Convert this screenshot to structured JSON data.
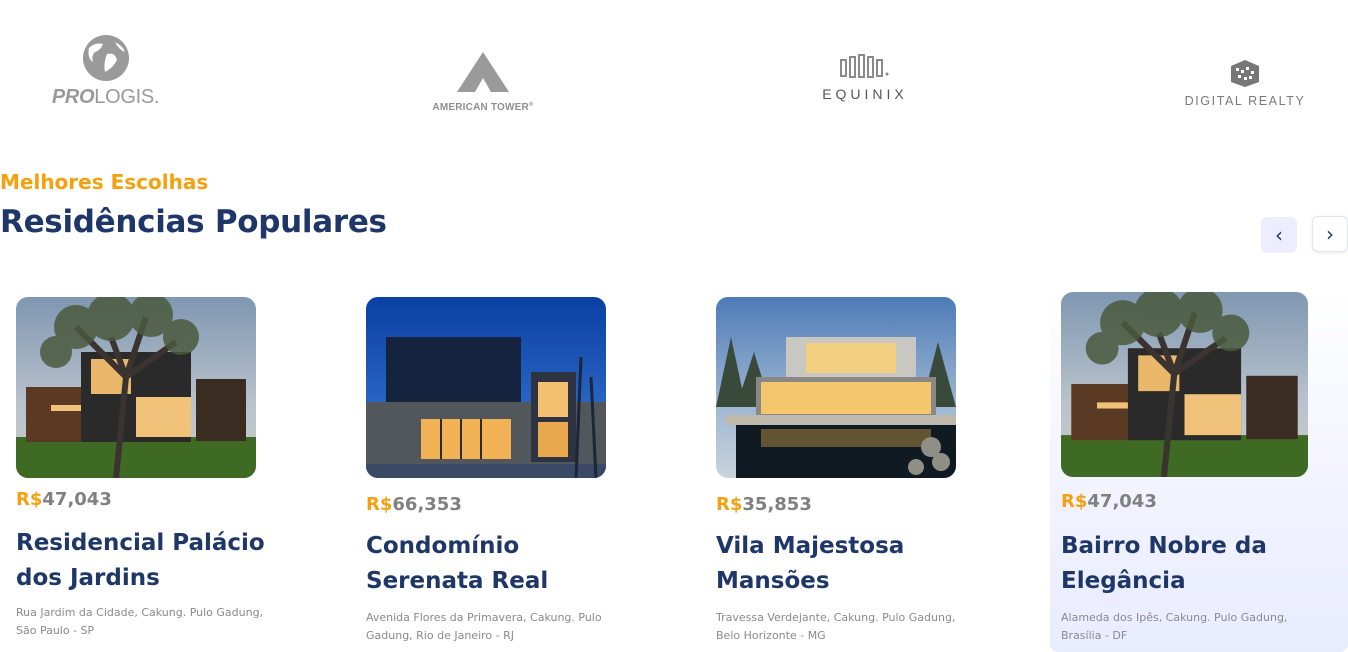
{
  "partners": [
    {
      "id": "prologis",
      "label_bold": "PRO",
      "label_rest": "LOGIS.",
      "icon": "globe-icon"
    },
    {
      "id": "american-tower",
      "label": "AMERICAN TOWER",
      "trademark": "®",
      "icon": "tower-peak-icon"
    },
    {
      "id": "equinix",
      "label": "EQUINIX",
      "icon": "equinix-bars-icon"
    },
    {
      "id": "digital-realty",
      "label": "DIGITAL REALTY",
      "icon": "digital-realty-cube-icon"
    }
  ],
  "section": {
    "eyebrow": "Melhores Escolhas",
    "title": "Residências Populares"
  },
  "carousel": {
    "prev_icon": "chevron-left-icon",
    "next_icon": "chevron-right-icon",
    "prev_glyph": "‹",
    "next_glyph": "›"
  },
  "properties": [
    {
      "currency": "R$",
      "price": "47,043",
      "name": "Residencial Palácio dos Jardins",
      "address": "Rua Jardim da Cidade, Cakung. Pulo Gadung, São Paulo - SP",
      "image": "modern-house-tree-photo"
    },
    {
      "currency": "R$",
      "price": "66,353",
      "name": "Condomínio Serenata Real",
      "address": "Avenida Flores da Primavera, Cakung. Pulo Gadung, Rio de Janeiro - RJ",
      "image": "modern-house-dusk-photo"
    },
    {
      "currency": "R$",
      "price": "35,853",
      "name": "Vila Majestosa Mansões",
      "address": "Travessa Verdejante, Cakung. Pulo Gadung, Belo Horizonte - MG",
      "image": "modern-house-pond-photo"
    },
    {
      "currency": "R$",
      "price": "47,043",
      "name": "Bairro Nobre da Elegância",
      "address": "Alameda dos Ipês, Cakung. Pulo Gadung, Brasília - DF",
      "image": "modern-house-tree-photo"
    }
  ],
  "colors": {
    "accent": "#f5a10f",
    "title": "#1e3768",
    "muted": "#808080",
    "nav_bg": "#eceeff"
  }
}
